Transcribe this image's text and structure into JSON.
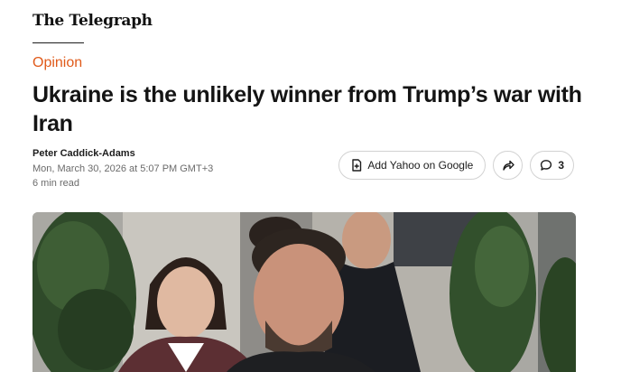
{
  "publisher": {
    "name": "The Telegraph"
  },
  "article": {
    "kicker": "Opinion",
    "headline": "Ukraine is the unlikely winner from Trump’s war with Iran",
    "author": "Peter Caddick-Adams",
    "timestamp": "Mon, March 30, 2026 at 5:07 PM GMT+3",
    "read_time": "6 min read"
  },
  "actions": {
    "add_google_label": "Add Yahoo on Google",
    "add_google_icon": "plus-document-icon",
    "share_icon": "share-arrow-icon",
    "comments_icon": "speech-bubble-icon",
    "comments_count": "3"
  },
  "colors": {
    "kicker": "#e05a1a"
  }
}
